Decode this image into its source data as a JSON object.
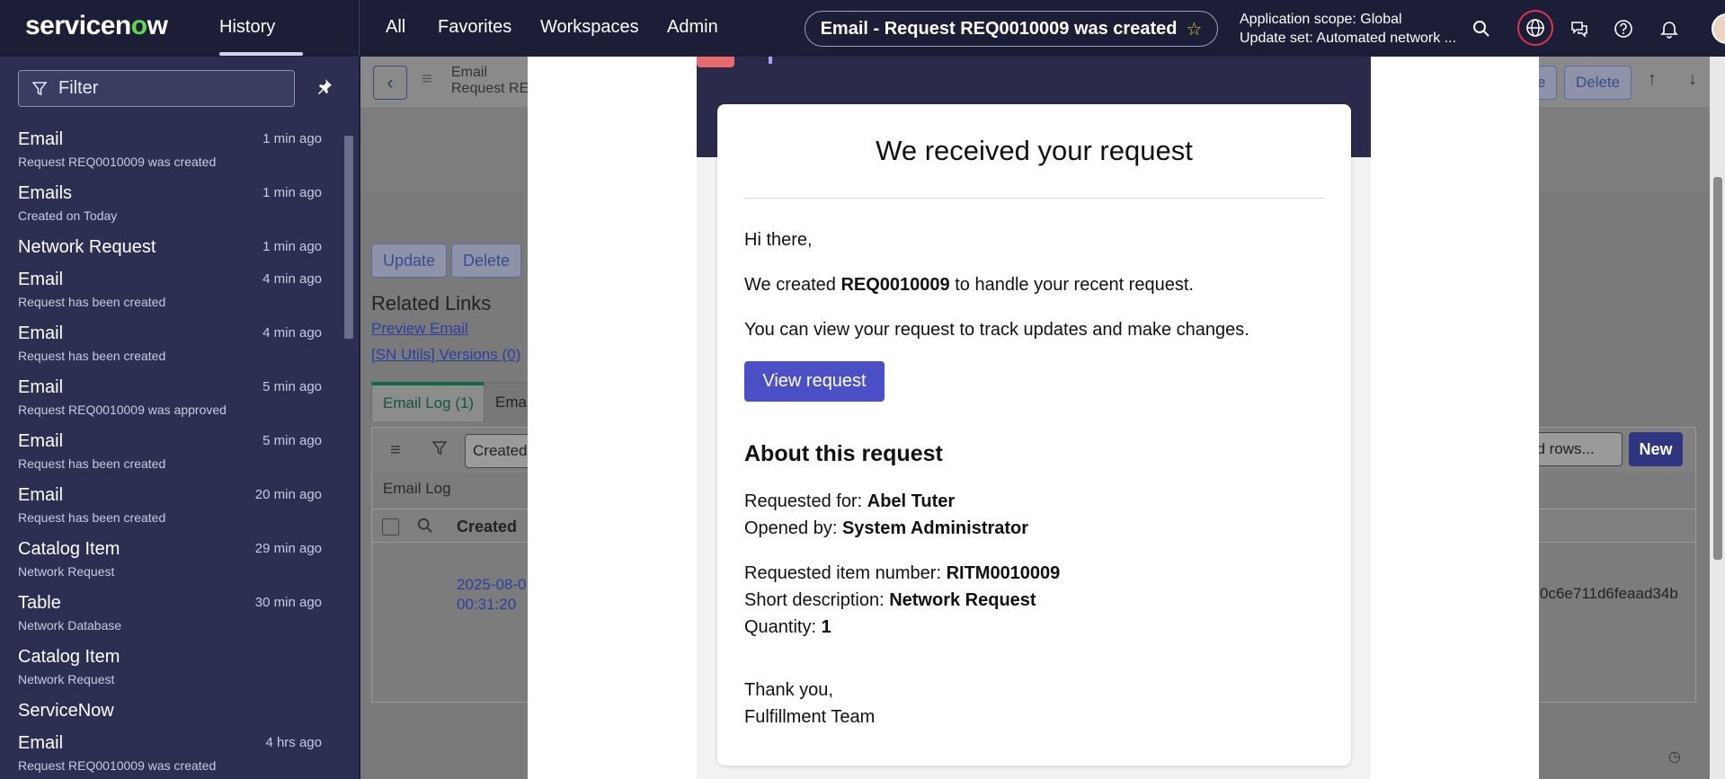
{
  "header": {
    "logo": {
      "pre": "servicen",
      "o": "o",
      "post": "w"
    },
    "history_tab": "History",
    "nav": [
      "All",
      "Favorites",
      "Workspaces",
      "Admin"
    ],
    "context_pill": "Email - Request REQ0010009 was created",
    "scope_line1": "Application scope: Global",
    "scope_line2": "Update set: Automated network ..."
  },
  "sidebar": {
    "filter_placeholder": "Filter",
    "items": [
      {
        "title": "Email",
        "subtitle": "Request REQ0010009 was created",
        "time": "1 min ago"
      },
      {
        "title": "Emails",
        "subtitle": "Created on Today",
        "time": "1 min ago"
      },
      {
        "title": "Network Request",
        "subtitle": "",
        "time": "1 min ago"
      },
      {
        "title": "Email",
        "subtitle": "Request has been created",
        "time": "4 min ago"
      },
      {
        "title": "Email",
        "subtitle": "Request has been created",
        "time": "4 min ago"
      },
      {
        "title": "Email",
        "subtitle": "Request REQ0010009 was approved",
        "time": "5 min ago"
      },
      {
        "title": "Email",
        "subtitle": "Request has been created",
        "time": "5 min ago"
      },
      {
        "title": "Email",
        "subtitle": "Request has been created",
        "time": "20 min ago"
      },
      {
        "title": "Catalog Item",
        "subtitle": "Network Request",
        "time": "29 min ago"
      },
      {
        "title": "Table",
        "subtitle": "Network Database",
        "time": "30 min ago"
      },
      {
        "title": "Catalog Item",
        "subtitle": "Network Request",
        "time": ""
      },
      {
        "title": "ServiceNow",
        "subtitle": "",
        "time": ""
      },
      {
        "title": "Email",
        "subtitle": "Request REQ0010009 was created",
        "time": "4 hrs ago"
      }
    ]
  },
  "record": {
    "title_line1": "Email",
    "title_line2": "Request RE",
    "header_buttons": [
      "e",
      "Delete"
    ],
    "action_buttons": [
      "Update",
      "Delete"
    ],
    "related_links_title": "Related Links",
    "related_links": [
      "Preview Email",
      "[SN Utils] Versions (0)"
    ],
    "tabs": [
      "Email Log (1)",
      "Emai"
    ],
    "list_filter_field": "Created",
    "list_label": "Email Log",
    "column_created": "Created",
    "row_date_line1": "2025-08-0",
    "row_date_line2": "00:31:20",
    "row_hash": "0c6e711d6feaad34b",
    "rows_select": "ed rows...",
    "new_button": "New"
  },
  "email": {
    "title": "We received your request",
    "greeting": "Hi there,",
    "line1_pre": "We created ",
    "line1_bold": "REQ0010009",
    "line1_post": " to handle your recent request.",
    "line2": "You can view your request to track updates and make changes.",
    "view_button": "View request",
    "about_title": "About this request",
    "requested_for_label": "Requested for: ",
    "requested_for": "Abel Tuter",
    "opened_by_label": "Opened by: ",
    "opened_by": "System Administrator",
    "item_number_label": "Requested item number: ",
    "item_number": "RITM0010009",
    "short_desc_label": "Short description: ",
    "short_desc": "Network Request",
    "quantity_label": "Quantity: ",
    "quantity": "1",
    "thanks": "Thank you,",
    "team": "Fulfillment Team"
  },
  "colors": {
    "header_bg": "#1b1e36",
    "sidebar_bg": "#2d2f52",
    "accent_button": "#4b50c6",
    "logo_o": "#62d84e",
    "globe_ring": "#e0334a"
  }
}
